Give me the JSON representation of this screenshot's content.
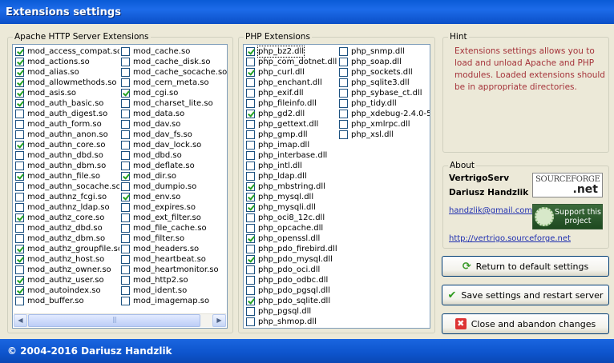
{
  "window": {
    "title": "Extensions settings",
    "footer": "© 2004-2016 Dariusz Handzlik"
  },
  "apache": {
    "title": "Apache HTTP Server Extensions",
    "col1": [
      {
        "label": "mod_access_compat.so",
        "checked": true
      },
      {
        "label": "mod_actions.so",
        "checked": true
      },
      {
        "label": "mod_alias.so",
        "checked": true
      },
      {
        "label": "mod_allowmethods.so",
        "checked": true
      },
      {
        "label": "mod_asis.so",
        "checked": true
      },
      {
        "label": "mod_auth_basic.so",
        "checked": true
      },
      {
        "label": "mod_auth_digest.so",
        "checked": false
      },
      {
        "label": "mod_auth_form.so",
        "checked": false
      },
      {
        "label": "mod_authn_anon.so",
        "checked": false
      },
      {
        "label": "mod_authn_core.so",
        "checked": true
      },
      {
        "label": "mod_authn_dbd.so",
        "checked": false
      },
      {
        "label": "mod_authn_dbm.so",
        "checked": false
      },
      {
        "label": "mod_authn_file.so",
        "checked": true
      },
      {
        "label": "mod_authn_socache.so",
        "checked": false
      },
      {
        "label": "mod_authnz_fcgi.so",
        "checked": false
      },
      {
        "label": "mod_authnz_ldap.so",
        "checked": false
      },
      {
        "label": "mod_authz_core.so",
        "checked": true
      },
      {
        "label": "mod_authz_dbd.so",
        "checked": false
      },
      {
        "label": "mod_authz_dbm.so",
        "checked": false
      },
      {
        "label": "mod_authz_groupfile.so",
        "checked": true
      },
      {
        "label": "mod_authz_host.so",
        "checked": true
      },
      {
        "label": "mod_authz_owner.so",
        "checked": false
      },
      {
        "label": "mod_authz_user.so",
        "checked": true
      },
      {
        "label": "mod_autoindex.so",
        "checked": true
      },
      {
        "label": "mod_buffer.so",
        "checked": false
      }
    ],
    "col2": [
      {
        "label": "mod_cache.so",
        "checked": false
      },
      {
        "label": "mod_cache_disk.so",
        "checked": false
      },
      {
        "label": "mod_cache_socache.so",
        "checked": false
      },
      {
        "label": "mod_cern_meta.so",
        "checked": false
      },
      {
        "label": "mod_cgi.so",
        "checked": true
      },
      {
        "label": "mod_charset_lite.so",
        "checked": false
      },
      {
        "label": "mod_data.so",
        "checked": false
      },
      {
        "label": "mod_dav.so",
        "checked": false
      },
      {
        "label": "mod_dav_fs.so",
        "checked": false
      },
      {
        "label": "mod_dav_lock.so",
        "checked": false
      },
      {
        "label": "mod_dbd.so",
        "checked": false
      },
      {
        "label": "mod_deflate.so",
        "checked": false
      },
      {
        "label": "mod_dir.so",
        "checked": true
      },
      {
        "label": "mod_dumpio.so",
        "checked": false
      },
      {
        "label": "mod_env.so",
        "checked": true
      },
      {
        "label": "mod_expires.so",
        "checked": false
      },
      {
        "label": "mod_ext_filter.so",
        "checked": false
      },
      {
        "label": "mod_file_cache.so",
        "checked": false
      },
      {
        "label": "mod_filter.so",
        "checked": false
      },
      {
        "label": "mod_headers.so",
        "checked": false
      },
      {
        "label": "mod_heartbeat.so",
        "checked": false
      },
      {
        "label": "mod_heartmonitor.so",
        "checked": false
      },
      {
        "label": "mod_http2.so",
        "checked": false
      },
      {
        "label": "mod_ident.so",
        "checked": false
      },
      {
        "label": "mod_imagemap.so",
        "checked": false
      }
    ]
  },
  "php": {
    "title": "PHP Extensions",
    "col1": [
      {
        "label": "php_bz2.dll",
        "checked": true,
        "focused": true
      },
      {
        "label": "php_com_dotnet.dll",
        "checked": false
      },
      {
        "label": "php_curl.dll",
        "checked": true
      },
      {
        "label": "php_enchant.dll",
        "checked": false
      },
      {
        "label": "php_exif.dll",
        "checked": false
      },
      {
        "label": "php_fileinfo.dll",
        "checked": false
      },
      {
        "label": "php_gd2.dll",
        "checked": true
      },
      {
        "label": "php_gettext.dll",
        "checked": false
      },
      {
        "label": "php_gmp.dll",
        "checked": false
      },
      {
        "label": "php_imap.dll",
        "checked": false
      },
      {
        "label": "php_interbase.dll",
        "checked": false
      },
      {
        "label": "php_intl.dll",
        "checked": false
      },
      {
        "label": "php_ldap.dll",
        "checked": false
      },
      {
        "label": "php_mbstring.dll",
        "checked": true
      },
      {
        "label": "php_mysql.dll",
        "checked": true
      },
      {
        "label": "php_mysqli.dll",
        "checked": true
      },
      {
        "label": "php_oci8_12c.dll",
        "checked": false
      },
      {
        "label": "php_opcache.dll",
        "checked": false
      },
      {
        "label": "php_openssl.dll",
        "checked": true
      },
      {
        "label": "php_pdo_firebird.dll",
        "checked": false
      },
      {
        "label": "php_pdo_mysql.dll",
        "checked": true
      },
      {
        "label": "php_pdo_oci.dll",
        "checked": false
      },
      {
        "label": "php_pdo_odbc.dll",
        "checked": false
      },
      {
        "label": "php_pdo_pgsql.dll",
        "checked": false
      },
      {
        "label": "php_pdo_sqlite.dll",
        "checked": true
      },
      {
        "label": "php_pgsql.dll",
        "checked": false
      },
      {
        "label": "php_shmop.dll",
        "checked": false
      }
    ],
    "col2": [
      {
        "label": "php_snmp.dll",
        "checked": false
      },
      {
        "label": "php_soap.dll",
        "checked": false
      },
      {
        "label": "php_sockets.dll",
        "checked": false
      },
      {
        "label": "php_sqlite3.dll",
        "checked": false
      },
      {
        "label": "php_sybase_ct.dll",
        "checked": false
      },
      {
        "label": "php_tidy.dll",
        "checked": false
      },
      {
        "label": "php_xdebug-2.4.0-5.",
        "checked": false
      },
      {
        "label": "php_xmlrpc.dll",
        "checked": false
      },
      {
        "label": "php_xsl.dll",
        "checked": false
      }
    ]
  },
  "hint": {
    "title": "Hint",
    "text": "Extensions settings allows you to load and unload Apache and PHP modules. Loaded extensions should be in appropriate directories."
  },
  "about": {
    "title": "About",
    "product": "VertrigoServ",
    "author": "Dariusz Handzlik",
    "email": "handzlik@gmail.com",
    "url": "http://vertrigo.sourceforge.net",
    "sourceforge_logo_top": "SOURCEFORGE",
    "sourceforge_logo_bottom": ".net",
    "support_badge": "Support this project"
  },
  "buttons": {
    "defaults": "Return to default settings",
    "save": "Save settings and restart server",
    "close": "Close and abandon changes"
  },
  "colors": {
    "titlebar": "#0b55d4",
    "hint_text": "#a5333a",
    "checkmark": "#21a121",
    "link": "#1f2fb0"
  }
}
